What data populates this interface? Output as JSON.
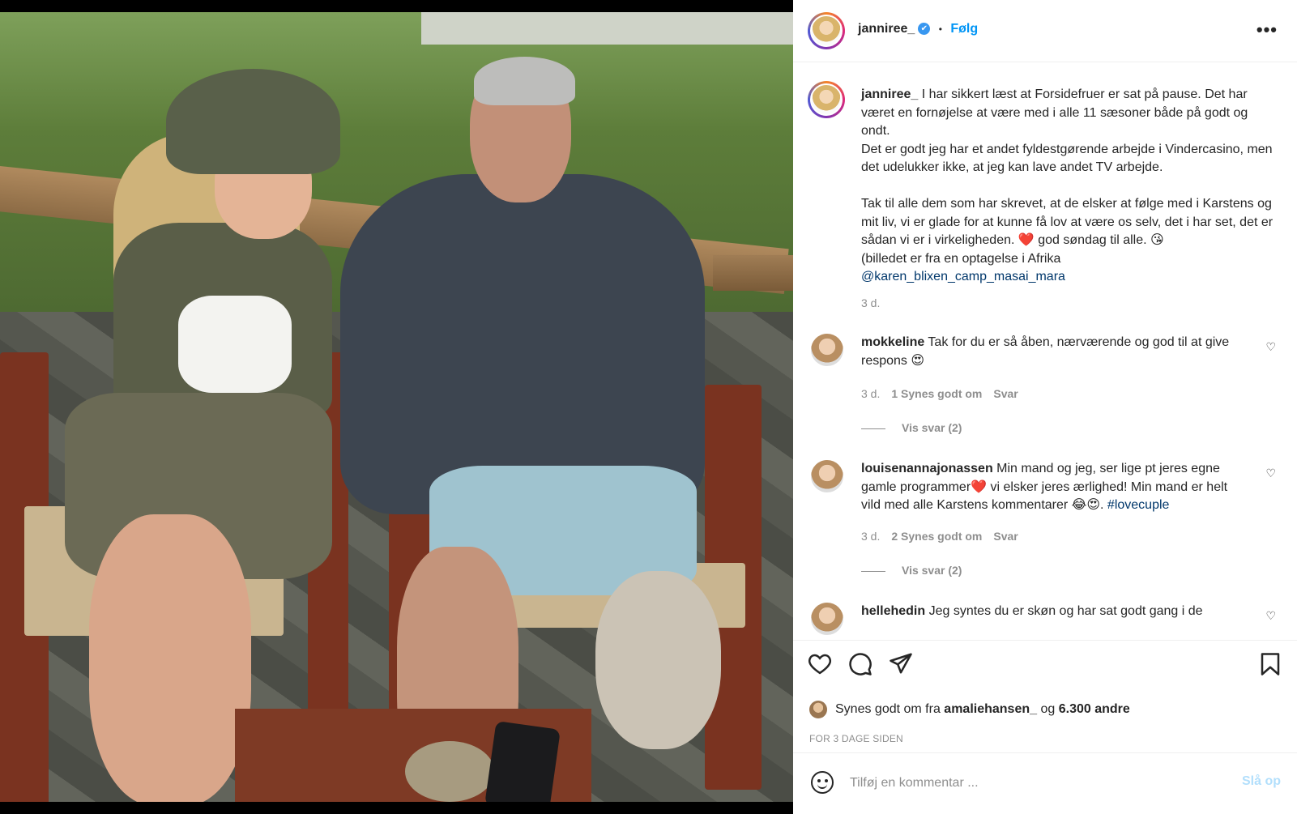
{
  "post": {
    "username": "janniree_",
    "verified_mark": "✔",
    "dot": "•",
    "follow_label": "Følg",
    "more_label": "•••"
  },
  "caption": {
    "username": "janniree_",
    "text": "I har sikkert læst at Forsidefruer er sat på pause. Det har været en fornøjelse at være med i alle 11 sæsoner både på godt og ondt.\nDet er godt jeg har et andet fyldestgørende arbejde i Vindercasino, men det udelukker ikke, at jeg kan lave andet TV arbejde.\n\nTak til alle dem som har skrevet, at de elsker at følge med i Karstens og mit liv, vi er glade for at kunne få lov at være os selv, det i har set, det er sådan vi er i virkeligheden.",
    "text_end": " god søndag til alle. 😘\n(billedet er fra en optagelse i Afrika\n",
    "heart_emoji": "❤️",
    "mention": "@karen_blixen_camp_masai_mara",
    "time": "3 d."
  },
  "comments": [
    {
      "username": "mokkeline",
      "text": "Tak for du er så åben, nærværende og god til at give respons 😍",
      "time": "3 d.",
      "likes": "1 Synes godt om",
      "reply": "Svar",
      "view_replies": "Vis svar (2)"
    },
    {
      "username": "louisenannajonassen",
      "text_a": "Min mand og jeg, ser lige pt jeres egne gamle programmer",
      "heart_emoji": "❤️",
      "text_b": " vi elsker jeres ærlighed! Min mand er helt vild med alle Karstens kommentarer 😂😍. ",
      "hashtag": "#lovecuple",
      "time": "3 d.",
      "likes": "2 Synes godt om",
      "reply": "Svar",
      "view_replies": "Vis svar (2)"
    },
    {
      "username": "hellehedin",
      "text": "Jeg syntes du er skøn og har sat godt gang i de"
    }
  ],
  "icons": {
    "like": "heart-icon",
    "comment": "comment-icon",
    "share": "send-icon",
    "save": "bookmark-icon",
    "comment_like": "heart-outline-icon",
    "emoji": "emoji-icon"
  },
  "likes": {
    "prefix": "Synes godt om fra",
    "user": "amaliehansen_",
    "joiner": "og",
    "others": "6.300 andre"
  },
  "posted_ago": "FOR 3 DAGE SIDEN",
  "add_comment": {
    "placeholder": "Tilføj en kommentar ...",
    "post_label": "Slå op"
  },
  "colors": {
    "link": "#0095f6",
    "mention": "#00376b",
    "muted": "#8e8e8e",
    "post_disabled": "#b2dffc"
  }
}
